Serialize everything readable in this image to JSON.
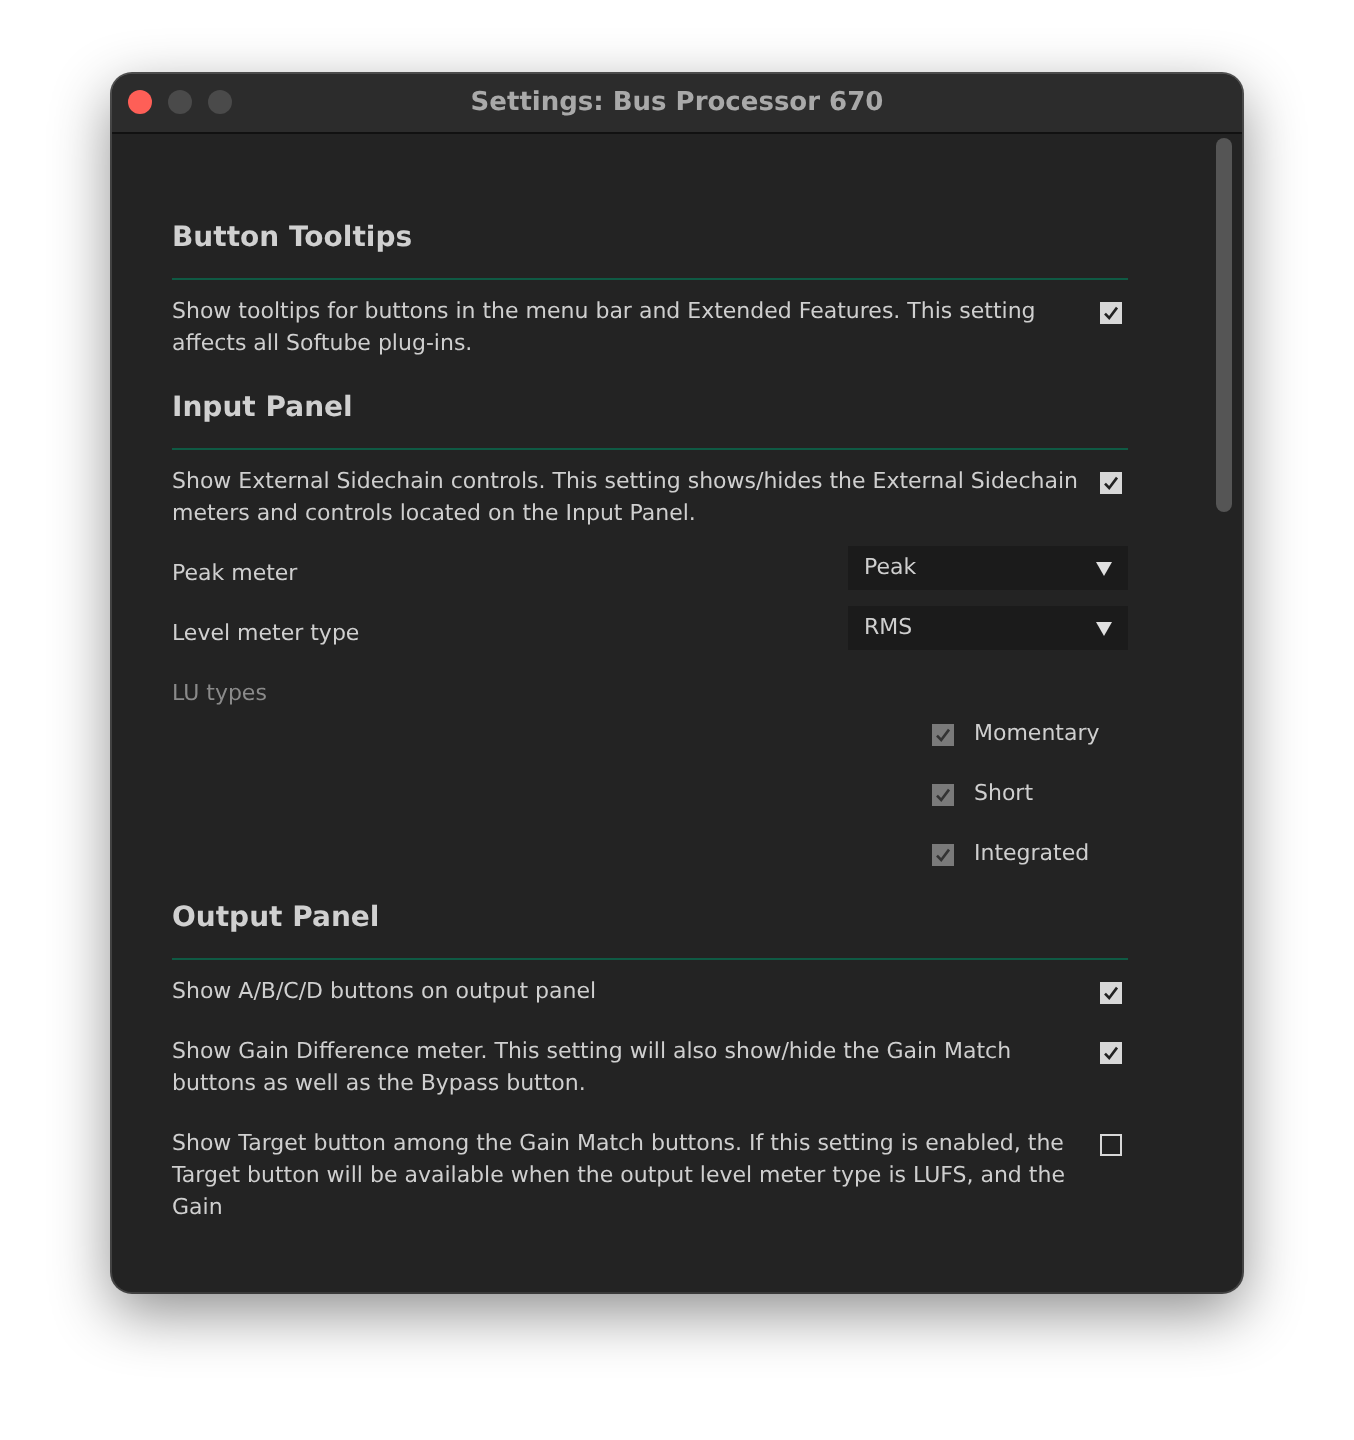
{
  "window": {
    "title": "Settings: Bus Processor 670"
  },
  "sections": [
    {
      "title": "Button Tooltips",
      "items": [
        {
          "kind": "checkbox",
          "label": "Show tooltips for buttons in the menu bar and Extended Features. This setting affects all Softube plug-ins.",
          "checked": true
        }
      ]
    },
    {
      "title": "Input Panel",
      "items": [
        {
          "kind": "checkbox",
          "label": "Show External Sidechain controls. This setting shows/hides the External Sidechain meters and controls located on the Input Panel.",
          "checked": true
        },
        {
          "kind": "dropdown",
          "label": "Peak meter",
          "value": "Peak"
        },
        {
          "kind": "dropdown",
          "label": "Level meter type",
          "value": "RMS"
        },
        {
          "kind": "group",
          "label": "LU types",
          "disabled": true,
          "options": [
            {
              "label": "Momentary",
              "checked": true
            },
            {
              "label": "Short",
              "checked": true
            },
            {
              "label": "Integrated",
              "checked": true
            }
          ]
        }
      ]
    },
    {
      "title": "Output Panel",
      "items": [
        {
          "kind": "checkbox",
          "label": "Show A/B/C/D buttons on output panel",
          "checked": true
        },
        {
          "kind": "checkbox",
          "label": "Show Gain Difference meter. This setting will also show/hide the Gain Match buttons as well as the Bypass button.",
          "checked": true
        },
        {
          "kind": "checkbox",
          "label": "Show Target button among the Gain Match buttons. If this setting is enabled, the Target button will be available when the output level meter type is LUFS, and the Gain",
          "checked": false
        }
      ]
    }
  ]
}
